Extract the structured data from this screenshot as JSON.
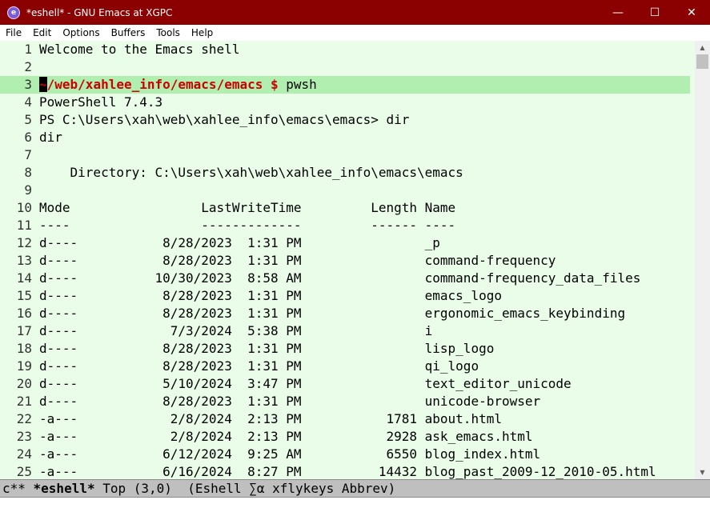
{
  "window": {
    "title": "*eshell* - GNU Emacs at XGPC",
    "minimize": "—",
    "maximize": "☐",
    "close": "✕",
    "icon": "emacs-icon"
  },
  "menu": [
    "File",
    "Edit",
    "Options",
    "Buffers",
    "Tools",
    "Help"
  ],
  "prompt": {
    "cursor_char": "~",
    "path": "/web/xahlee_info/emacs/emacs $",
    "command": " pwsh"
  },
  "lines": [
    {
      "n": "1",
      "text": "Welcome to the Emacs shell"
    },
    {
      "n": "2",
      "text": ""
    },
    {
      "n": "3",
      "text": ""
    },
    {
      "n": "4",
      "text": "PowerShell 7.4.3"
    },
    {
      "n": "5",
      "text": "PS C:\\Users\\xah\\web\\xahlee_info\\emacs\\emacs> dir"
    },
    {
      "n": "6",
      "text": "dir"
    },
    {
      "n": "7",
      "text": ""
    },
    {
      "n": "8",
      "text": "    Directory: C:\\Users\\xah\\web\\xahlee_info\\emacs\\emacs"
    },
    {
      "n": "9",
      "text": ""
    },
    {
      "n": "10",
      "text": "Mode                 LastWriteTime         Length Name"
    },
    {
      "n": "11",
      "text": "----                 -------------         ------ ----"
    },
    {
      "n": "12",
      "text": "d----           8/28/2023  1:31 PM                _p"
    },
    {
      "n": "13",
      "text": "d----           8/28/2023  1:31 PM                command-frequency"
    },
    {
      "n": "14",
      "text": "d----          10/30/2023  8:58 AM                command-frequency_data_files"
    },
    {
      "n": "15",
      "text": "d----           8/28/2023  1:31 PM                emacs_logo"
    },
    {
      "n": "16",
      "text": "d----           8/28/2023  1:31 PM                ergonomic_emacs_keybinding"
    },
    {
      "n": "17",
      "text": "d----            7/3/2024  5:38 PM                i"
    },
    {
      "n": "18",
      "text": "d----           8/28/2023  1:31 PM                lisp_logo"
    },
    {
      "n": "19",
      "text": "d----           8/28/2023  1:31 PM                qi_logo"
    },
    {
      "n": "20",
      "text": "d----           5/10/2024  3:47 PM                text_editor_unicode"
    },
    {
      "n": "21",
      "text": "d----           8/28/2023  1:31 PM                unicode-browser"
    },
    {
      "n": "22",
      "text": "-a---            2/8/2024  2:13 PM           1781 about.html"
    },
    {
      "n": "23",
      "text": "-a---            2/8/2024  2:13 PM           2928 ask_emacs.html"
    },
    {
      "n": "24",
      "text": "-a---           6/12/2024  9:25 AM           6550 blog_index.html"
    },
    {
      "n": "25",
      "text": "-a---           6/16/2024  8:27 PM          14432 blog_past_2009-12_2010-05.html"
    }
  ],
  "modeline": {
    "prefix": "c** ",
    "buffer": "*eshell*",
    "rest": " Top (3,0)  (Eshell ∑α xflykeys Abbrev)"
  }
}
